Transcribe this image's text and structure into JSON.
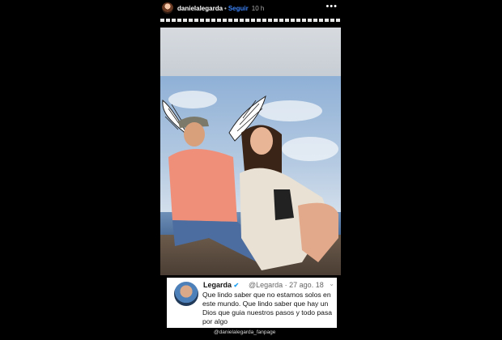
{
  "header": {
    "username": "danielalegarda",
    "separator": "•",
    "follow_label": "Seguir",
    "time": "10 h",
    "more_icon": "more-icon"
  },
  "tweet": {
    "name": "Legarda",
    "verified_icon": "verified-icon",
    "handle_date": "@Legarda · 27 ago. 18",
    "chevron_icon": "chevron-down-icon",
    "text": "Que lindo saber que no estamos solos en este mundo. Que lindo saber que hay un Dios que guia nuestros pasos y todo pasa por algo"
  },
  "watermark": "@danielalegarda_fanpage",
  "colors": {
    "follow": "#3b82f6",
    "verified": "#1da1f2",
    "background": "#000000"
  }
}
